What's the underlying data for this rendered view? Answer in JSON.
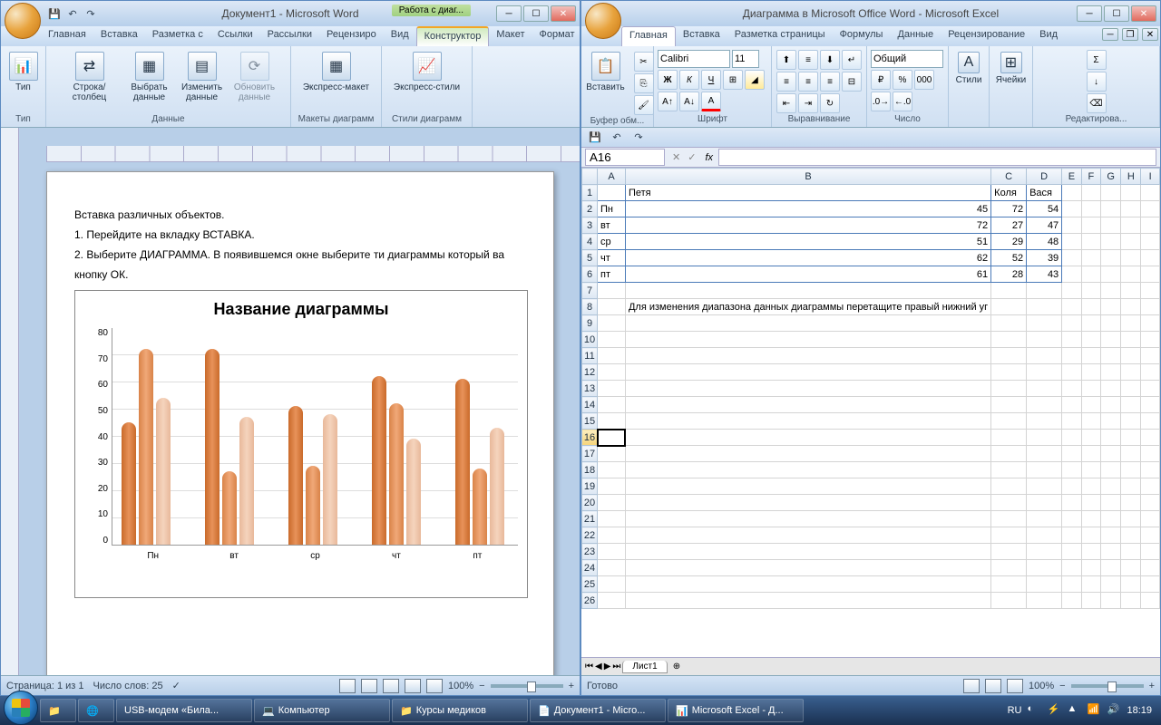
{
  "word": {
    "title": "Документ1 - Microsoft Word",
    "chart_tools": "Работа с диаг...",
    "tabs": [
      "Главная",
      "Вставка",
      "Разметка с",
      "Ссылки",
      "Рассылки",
      "Рецензиро",
      "Вид",
      "Конструктор",
      "Макет",
      "Формат"
    ],
    "groups": {
      "type": "Тип",
      "data": "Данные",
      "layouts": "Макеты диаграмм",
      "styles": "Стили диаграмм",
      "btn_type": "Тип",
      "btn_rowcol": "Строка/столбец",
      "btn_select": "Выбрать данные",
      "btn_edit": "Изменить данные",
      "btn_refresh": "Обновить данные",
      "btn_layout": "Экспресс-макет",
      "btn_styles": "Экспресс-стили"
    },
    "doc": {
      "p1": "Вставка различных объектов.",
      "p2": "1. Перейдите на вкладку ВСТАВКА.",
      "p3": "2. Выберите ДИАГРАММА. В появившемся окне выберите ти диаграммы который ва",
      "p4": "кнопку ОК."
    },
    "status": {
      "page": "Страница: 1 из 1",
      "words": "Число слов: 25",
      "zoom": "100%"
    }
  },
  "excel": {
    "title": "Диаграмма в Microsoft Office Word - Microsoft Excel",
    "tabs": [
      "Главная",
      "Вставка",
      "Разметка страницы",
      "Формулы",
      "Данные",
      "Рецензирование",
      "Вид"
    ],
    "groups": {
      "clipboard": "Буфер обм...",
      "font": "Шрифт",
      "align": "Выравнивание",
      "number": "Число",
      "styles": "Стили",
      "cells": "Ячейки",
      "edit": "Редактирова..."
    },
    "paste": "Вставить",
    "font_name": "Calibri",
    "font_size": "11",
    "number_fmt": "Общий",
    "cell_ref": "A16",
    "fx": "",
    "cols": [
      "A",
      "B",
      "C",
      "D",
      "E",
      "F",
      "G",
      "H",
      "I"
    ],
    "rows": [
      1,
      2,
      3,
      4,
      5,
      6,
      7,
      8,
      9,
      10,
      11,
      12,
      13,
      14,
      15,
      16,
      17,
      18,
      19,
      20,
      21,
      22,
      23,
      24,
      25,
      26
    ],
    "headers_row": [
      "",
      "Петя",
      "Коля",
      "Вася"
    ],
    "data": [
      [
        "Пн",
        45,
        72,
        54
      ],
      [
        "вт",
        72,
        27,
        47
      ],
      [
        "ср",
        51,
        29,
        48
      ],
      [
        "чт",
        62,
        52,
        39
      ],
      [
        "пт",
        61,
        28,
        43
      ]
    ],
    "note": "Для изменения диапазона данных диаграммы перетащите правый нижний уг",
    "sheet": "Лист1",
    "status": "Готово",
    "zoom": "100%"
  },
  "chart_data": {
    "type": "bar",
    "title": "Название диаграммы",
    "categories": [
      "Пн",
      "вт",
      "ср",
      "чт",
      "пт"
    ],
    "series": [
      {
        "name": "Петя",
        "values": [
          45,
          72,
          51,
          62,
          61
        ]
      },
      {
        "name": "Коля",
        "values": [
          72,
          27,
          29,
          52,
          28
        ]
      },
      {
        "name": "Вася",
        "values": [
          54,
          47,
          48,
          39,
          43
        ]
      }
    ],
    "ylim": [
      0,
      80
    ],
    "yticks": [
      0,
      10,
      20,
      30,
      40,
      50,
      60,
      70,
      80
    ]
  },
  "taskbar": {
    "items": [
      "USB-модем «Била...",
      "Компьютер",
      "Курсы медиков",
      "Документ1 - Micro...",
      "Microsoft Excel - Д..."
    ],
    "lang": "RU",
    "time": "18:19"
  }
}
